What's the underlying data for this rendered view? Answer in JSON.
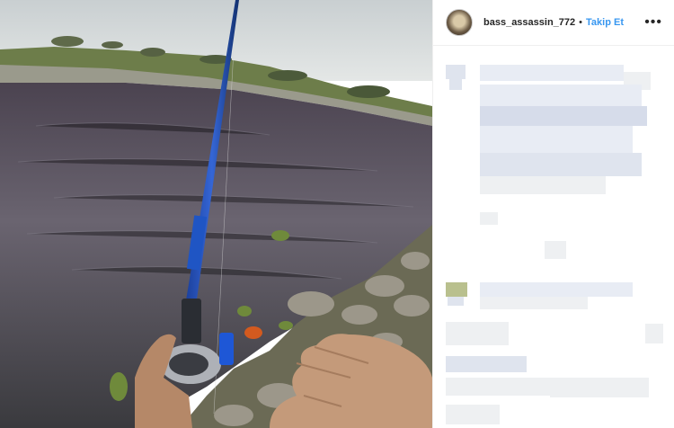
{
  "post": {
    "username": "bass_assassin_772",
    "separator": "•",
    "follow_label": "Takip Et",
    "more_label": "•••",
    "icons": {
      "avatar": "user-avatar",
      "more": "more-options-icon"
    },
    "colors": {
      "follow": "#3897f0",
      "text": "#262626",
      "border": "#efefef"
    }
  }
}
